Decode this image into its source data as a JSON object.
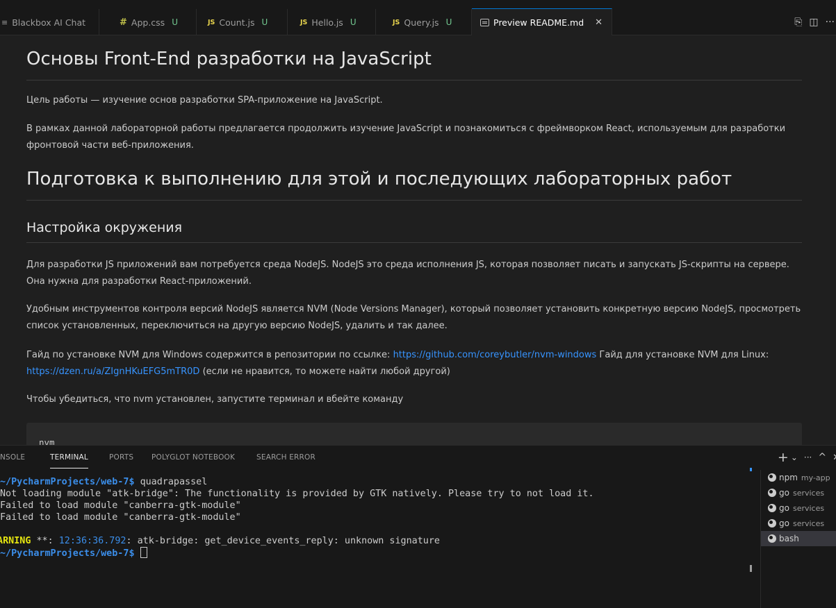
{
  "tabs": [
    {
      "icon": "blackbox-icon",
      "label": "Blackbox AI Chat",
      "modified": "",
      "glyph": "≡"
    },
    {
      "icon": "css-icon",
      "label": "App.css",
      "modified": "U",
      "glyph": "#"
    },
    {
      "icon": "js-icon",
      "label": "Count.js",
      "modified": "U",
      "glyph": "JS"
    },
    {
      "icon": "js-icon",
      "label": "Hello.js",
      "modified": "U",
      "glyph": "JS"
    },
    {
      "icon": "js-icon",
      "label": "Query.js",
      "modified": "U",
      "glyph": "JS"
    },
    {
      "icon": "preview-icon",
      "label": "Preview README.md",
      "modified": "",
      "glyph": "",
      "close": "✕"
    }
  ],
  "tab_actions": {
    "open_changes": "⎘",
    "split": "◫",
    "more": "···"
  },
  "doc": {
    "h1": "Основы Front-End разработки на JavaScript",
    "p1": "Цель работы — изучение основ разработки SPA-приложение на JavaScript.",
    "p2": "В рамках данной лабораторной работы предлагается продолжить изучение JavaScript и познакомиться с фреймворком React, используемым для разработки фронтовой части веб-приложения.",
    "h2": "Подготовка к выполнению для этой и последующих лабораторных работ",
    "h3": "Настройка окружения",
    "p3": "Для разработки JS приложений вам потребуется среда NodeJS. NodeJS это среда исполнения JS, которая позволяет писать и запускать JS-скрипты на сервере. Она нужна для разработки React-приложений.",
    "p4": "Удобным инструментов контроля версий NodeJS является NVM (Node Versions Manager), который позволяет установить конкретную версию NodeJS, просмотреть список установленных, переключиться на другую версию NodeJS, удалить и так далее.",
    "p5_a": "Гайд по установке NVM для Windows содержится в репозитории по ссылке: ",
    "p5_link1": "https://github.com/coreybutler/nvm-windows",
    "p5_b": " Гайд для установке NVM для Linux: ",
    "p5_link2": "https://dzen.ru/a/ZIgnHKuEFG5mTR0D",
    "p5_c": " (если не нравится, то можете найти любой другой)",
    "p6": "Чтобы убедиться, что nvm установлен, запустите терминал и вбейте команду",
    "code": "nvm"
  },
  "panel": {
    "tabs": [
      "NSOLE",
      "TERMINAL",
      "PORTS",
      "POLYGLOT NOTEBOOK",
      "SEARCH ERROR"
    ],
    "active_tab": "TERMINAL",
    "actions": {
      "new": "+",
      "dropdown": "⌄",
      "more": "···",
      "maximize": "^",
      "close": "✕"
    }
  },
  "terminal": {
    "prompt1_path": "~/PycharmProjects/web-7",
    "prompt1_sym": "$ ",
    "prompt1_cmd": "quadrapassel",
    "line2": "Not loading module \"atk-bridge\": The functionality is provided by GTK natively. Please try to not load it.",
    "line3": "Failed to load module \"canberra-gtk-module\"",
    "line4": "Failed to load module \"canberra-gtk-module\"",
    "warn_label": "WARNING",
    "warn_mid": " **: ",
    "warn_time": "12:36:36.792",
    "warn_rest": ": atk-bridge: get_device_events_reply: unknown signature",
    "prompt2_path": "~/PycharmProjects/web-7",
    "prompt2_sym": "$ "
  },
  "terminal_list": [
    {
      "name": "npm",
      "sub": "my-app"
    },
    {
      "name": "go",
      "sub": "services"
    },
    {
      "name": "go",
      "sub": "services"
    },
    {
      "name": "go",
      "sub": "services"
    },
    {
      "name": "bash",
      "sub": ""
    }
  ],
  "terminal_list_selected": 4
}
